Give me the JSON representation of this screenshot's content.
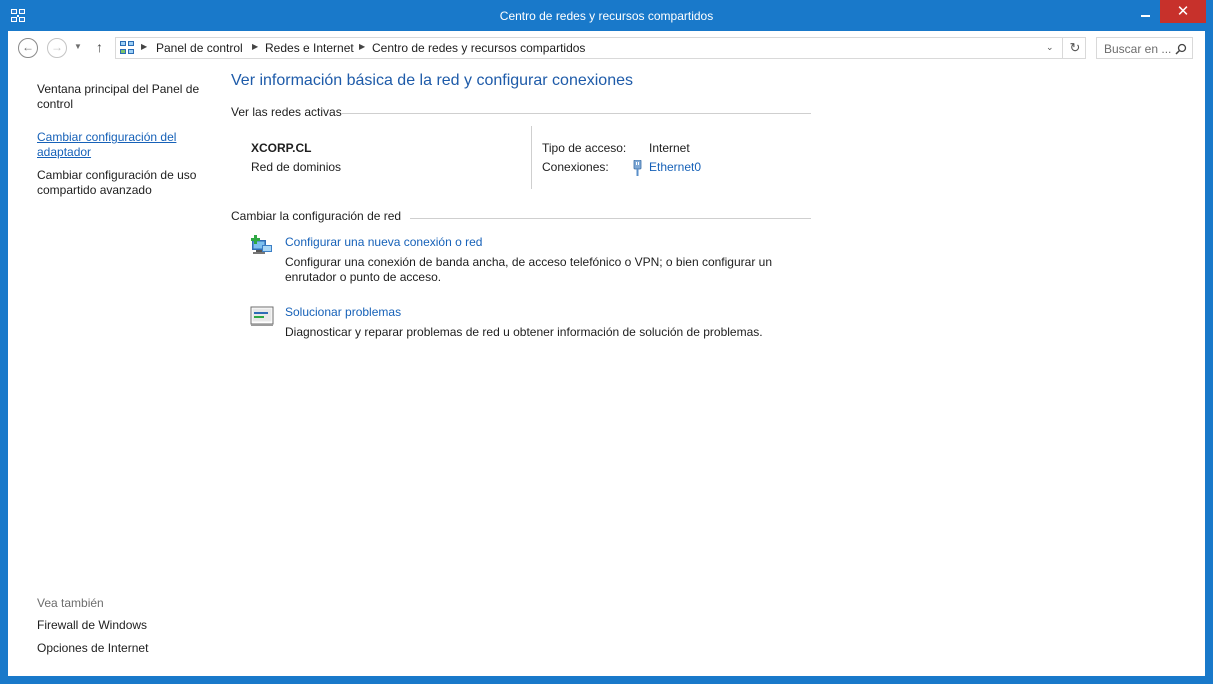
{
  "window": {
    "title": "Centro de redes y recursos compartidos",
    "minimize_glyph": "",
    "close_glyph": "✕"
  },
  "address_bar": {
    "back_glyph": "←",
    "forward_glyph": "→",
    "dropdown_glyph": "▼",
    "up_glyph": "↑",
    "separator_glyph": "▶",
    "breadcrumbs": [
      "Panel de control",
      "Redes e Internet",
      "Centro de redes y recursos compartidos"
    ],
    "dropdown_arrow": "⌄",
    "refresh_glyph": "↻"
  },
  "search": {
    "placeholder": "Buscar en ...",
    "icon_glyph": "⚲"
  },
  "left_pane": {
    "links": [
      "Ventana principal del Panel de control",
      "Cambiar configuración del adaptador",
      "Cambiar configuración de uso compartido avanzado"
    ],
    "see_also_heading": "Vea también",
    "see_also_links": [
      "Firewall de Windows",
      "Opciones de Internet"
    ]
  },
  "main": {
    "title": "Ver información básica de la red y configurar conexiones",
    "active_networks": {
      "heading": "Ver las redes activas",
      "network_name": "XCORP.CL",
      "network_category": "Red de dominios",
      "access_type_label": "Tipo de acceso:",
      "access_type_value": "Internet",
      "connections_label": "Conexiones:",
      "connection_name": "Ethernet0"
    },
    "change_settings": {
      "heading": "Cambiar la configuración de red",
      "tasks": [
        {
          "link": "Configurar una nueva conexión o red",
          "description": "Configurar una conexión de banda ancha, de acceso telefónico o VPN; o bien configurar un enrutador o punto de acceso.",
          "icon": "new-connection-icon"
        },
        {
          "link": "Solucionar problemas",
          "description": "Diagnosticar y reparar problemas de red u obtener información de solución de problemas.",
          "icon": "troubleshoot-icon"
        }
      ]
    }
  },
  "colors": {
    "frame": "#1979ca",
    "link": "#1661b8",
    "title": "#1e5ba9",
    "close": "#c7312b"
  }
}
